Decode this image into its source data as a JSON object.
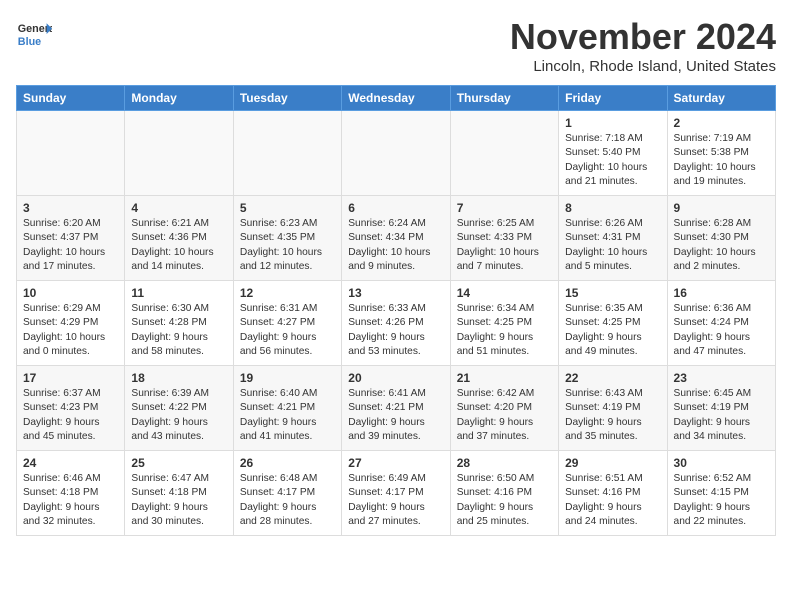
{
  "logo": {
    "line1": "General",
    "line2": "Blue"
  },
  "title": "November 2024",
  "subtitle": "Lincoln, Rhode Island, United States",
  "days_of_week": [
    "Sunday",
    "Monday",
    "Tuesday",
    "Wednesday",
    "Thursday",
    "Friday",
    "Saturday"
  ],
  "weeks": [
    [
      {
        "day": "",
        "info": ""
      },
      {
        "day": "",
        "info": ""
      },
      {
        "day": "",
        "info": ""
      },
      {
        "day": "",
        "info": ""
      },
      {
        "day": "",
        "info": ""
      },
      {
        "day": "1",
        "info": "Sunrise: 7:18 AM\nSunset: 5:40 PM\nDaylight: 10 hours\nand 21 minutes."
      },
      {
        "day": "2",
        "info": "Sunrise: 7:19 AM\nSunset: 5:38 PM\nDaylight: 10 hours\nand 19 minutes."
      }
    ],
    [
      {
        "day": "3",
        "info": "Sunrise: 6:20 AM\nSunset: 4:37 PM\nDaylight: 10 hours\nand 17 minutes."
      },
      {
        "day": "4",
        "info": "Sunrise: 6:21 AM\nSunset: 4:36 PM\nDaylight: 10 hours\nand 14 minutes."
      },
      {
        "day": "5",
        "info": "Sunrise: 6:23 AM\nSunset: 4:35 PM\nDaylight: 10 hours\nand 12 minutes."
      },
      {
        "day": "6",
        "info": "Sunrise: 6:24 AM\nSunset: 4:34 PM\nDaylight: 10 hours\nand 9 minutes."
      },
      {
        "day": "7",
        "info": "Sunrise: 6:25 AM\nSunset: 4:33 PM\nDaylight: 10 hours\nand 7 minutes."
      },
      {
        "day": "8",
        "info": "Sunrise: 6:26 AM\nSunset: 4:31 PM\nDaylight: 10 hours\nand 5 minutes."
      },
      {
        "day": "9",
        "info": "Sunrise: 6:28 AM\nSunset: 4:30 PM\nDaylight: 10 hours\nand 2 minutes."
      }
    ],
    [
      {
        "day": "10",
        "info": "Sunrise: 6:29 AM\nSunset: 4:29 PM\nDaylight: 10 hours\nand 0 minutes."
      },
      {
        "day": "11",
        "info": "Sunrise: 6:30 AM\nSunset: 4:28 PM\nDaylight: 9 hours\nand 58 minutes."
      },
      {
        "day": "12",
        "info": "Sunrise: 6:31 AM\nSunset: 4:27 PM\nDaylight: 9 hours\nand 56 minutes."
      },
      {
        "day": "13",
        "info": "Sunrise: 6:33 AM\nSunset: 4:26 PM\nDaylight: 9 hours\nand 53 minutes."
      },
      {
        "day": "14",
        "info": "Sunrise: 6:34 AM\nSunset: 4:25 PM\nDaylight: 9 hours\nand 51 minutes."
      },
      {
        "day": "15",
        "info": "Sunrise: 6:35 AM\nSunset: 4:25 PM\nDaylight: 9 hours\nand 49 minutes."
      },
      {
        "day": "16",
        "info": "Sunrise: 6:36 AM\nSunset: 4:24 PM\nDaylight: 9 hours\nand 47 minutes."
      }
    ],
    [
      {
        "day": "17",
        "info": "Sunrise: 6:37 AM\nSunset: 4:23 PM\nDaylight: 9 hours\nand 45 minutes."
      },
      {
        "day": "18",
        "info": "Sunrise: 6:39 AM\nSunset: 4:22 PM\nDaylight: 9 hours\nand 43 minutes."
      },
      {
        "day": "19",
        "info": "Sunrise: 6:40 AM\nSunset: 4:21 PM\nDaylight: 9 hours\nand 41 minutes."
      },
      {
        "day": "20",
        "info": "Sunrise: 6:41 AM\nSunset: 4:21 PM\nDaylight: 9 hours\nand 39 minutes."
      },
      {
        "day": "21",
        "info": "Sunrise: 6:42 AM\nSunset: 4:20 PM\nDaylight: 9 hours\nand 37 minutes."
      },
      {
        "day": "22",
        "info": "Sunrise: 6:43 AM\nSunset: 4:19 PM\nDaylight: 9 hours\nand 35 minutes."
      },
      {
        "day": "23",
        "info": "Sunrise: 6:45 AM\nSunset: 4:19 PM\nDaylight: 9 hours\nand 34 minutes."
      }
    ],
    [
      {
        "day": "24",
        "info": "Sunrise: 6:46 AM\nSunset: 4:18 PM\nDaylight: 9 hours\nand 32 minutes."
      },
      {
        "day": "25",
        "info": "Sunrise: 6:47 AM\nSunset: 4:18 PM\nDaylight: 9 hours\nand 30 minutes."
      },
      {
        "day": "26",
        "info": "Sunrise: 6:48 AM\nSunset: 4:17 PM\nDaylight: 9 hours\nand 28 minutes."
      },
      {
        "day": "27",
        "info": "Sunrise: 6:49 AM\nSunset: 4:17 PM\nDaylight: 9 hours\nand 27 minutes."
      },
      {
        "day": "28",
        "info": "Sunrise: 6:50 AM\nSunset: 4:16 PM\nDaylight: 9 hours\nand 25 minutes."
      },
      {
        "day": "29",
        "info": "Sunrise: 6:51 AM\nSunset: 4:16 PM\nDaylight: 9 hours\nand 24 minutes."
      },
      {
        "day": "30",
        "info": "Sunrise: 6:52 AM\nSunset: 4:15 PM\nDaylight: 9 hours\nand 22 minutes."
      }
    ]
  ]
}
